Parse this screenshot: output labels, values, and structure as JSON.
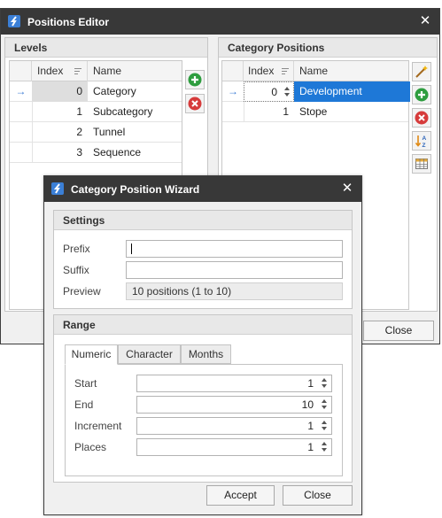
{
  "main": {
    "title": "Positions Editor",
    "levels": {
      "title": "Levels",
      "columns": [
        "Index",
        "Name"
      ],
      "rows": [
        {
          "index": "0",
          "name": "Category"
        },
        {
          "index": "1",
          "name": "Subcategory"
        },
        {
          "index": "2",
          "name": "Tunnel"
        },
        {
          "index": "3",
          "name": "Sequence"
        }
      ]
    },
    "category_positions": {
      "title": "Category Positions",
      "columns": [
        "Index",
        "Name"
      ],
      "rows": [
        {
          "index": "0",
          "name": "Development"
        },
        {
          "index": "1",
          "name": "Stope"
        }
      ]
    },
    "close_label": "Close"
  },
  "wizard": {
    "title": "Category Position Wizard",
    "settings": {
      "title": "Settings",
      "prefix_label": "Prefix",
      "prefix_value": "",
      "suffix_label": "Suffix",
      "suffix_value": "",
      "preview_label": "Preview",
      "preview_value": "10 positions (1 to 10)"
    },
    "range": {
      "title": "Range",
      "tabs": [
        "Numeric",
        "Character",
        "Months"
      ],
      "active_tab": "Numeric",
      "start_label": "Start",
      "start_value": "1",
      "end_label": "End",
      "end_value": "10",
      "increment_label": "Increment",
      "increment_value": "1",
      "places_label": "Places",
      "places_value": "1"
    },
    "accept_label": "Accept",
    "close_label": "Close"
  },
  "colors": {
    "titlebar": "#383838",
    "selection": "#1e78d7",
    "add_green": "#2e9d3f",
    "delete_red": "#d63b3b"
  }
}
